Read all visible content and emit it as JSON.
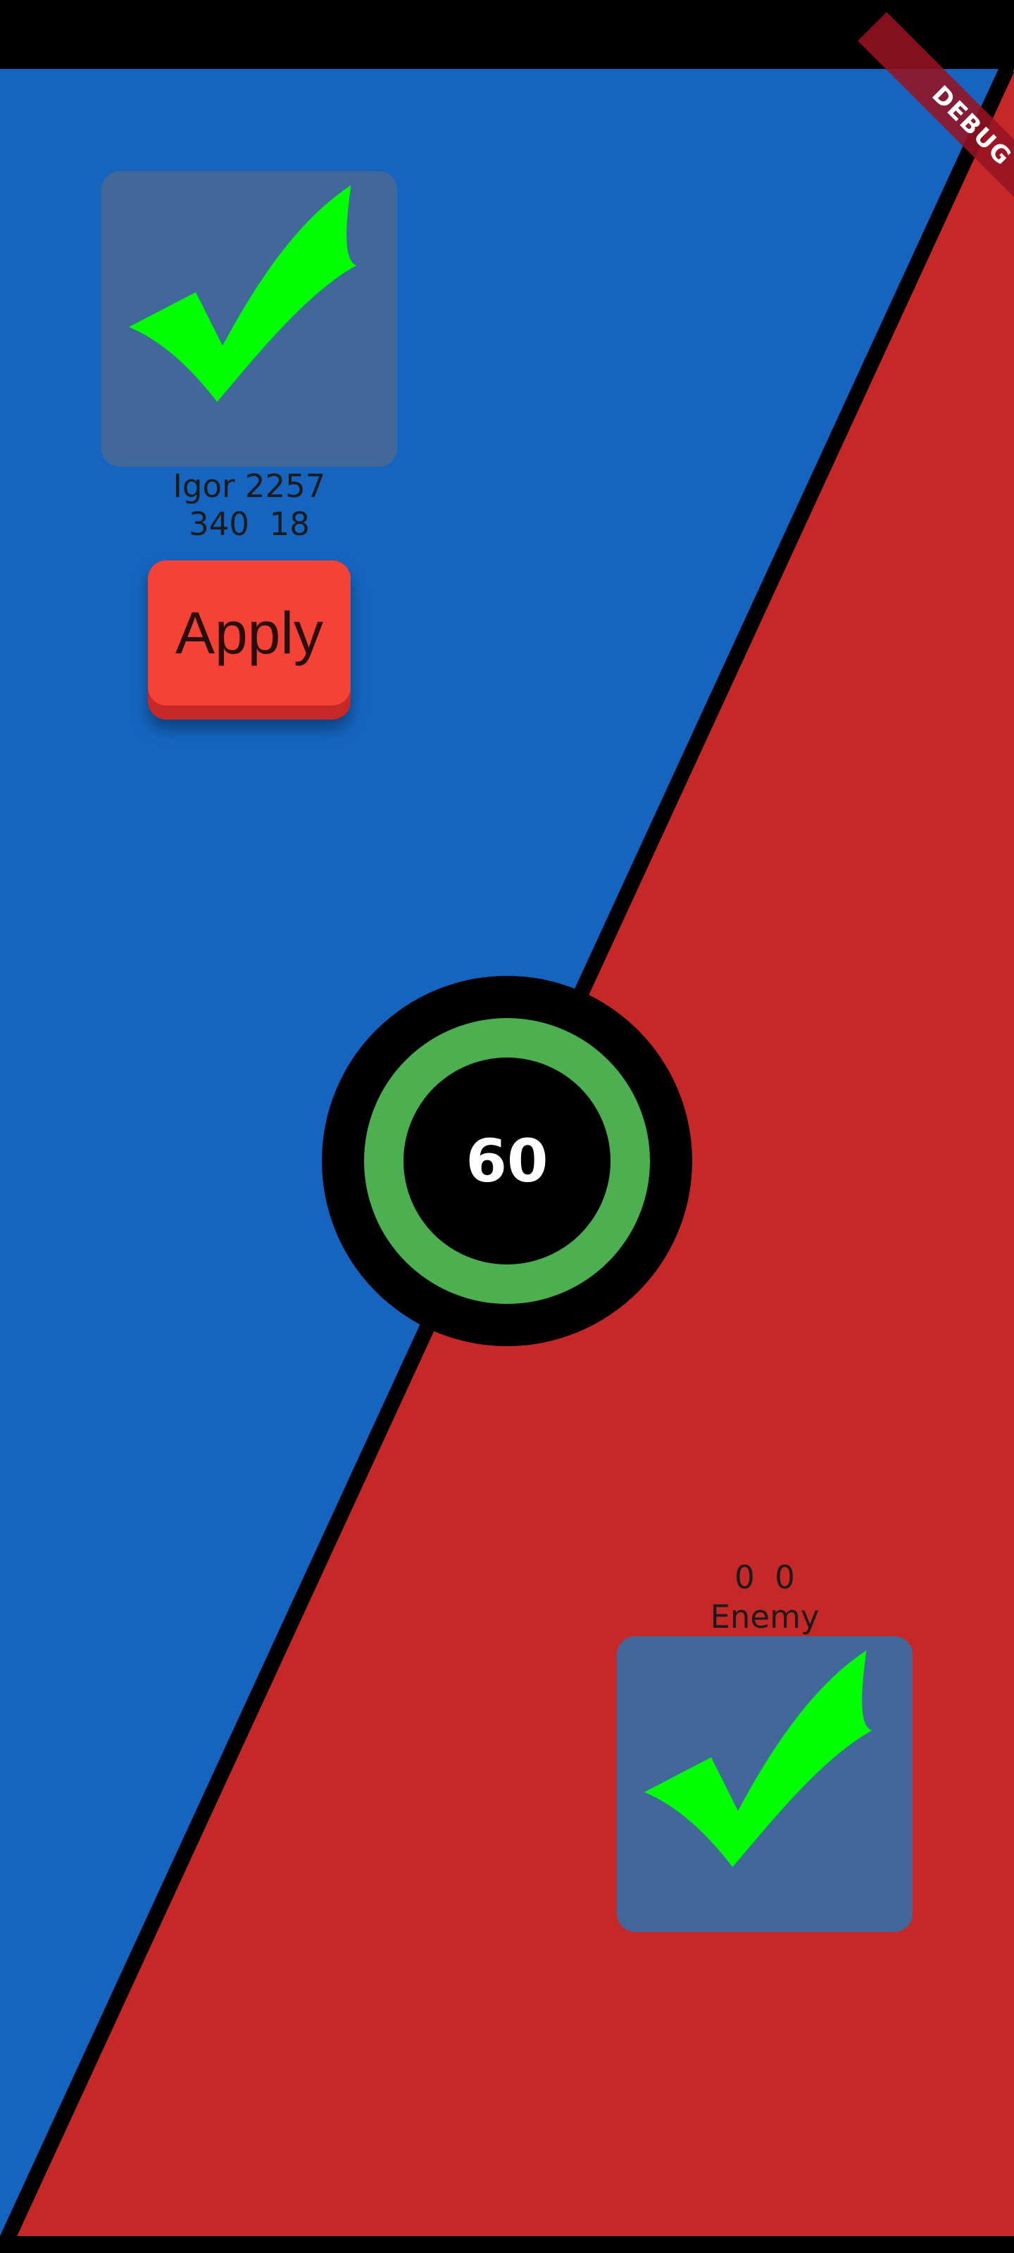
{
  "player": {
    "name_line": "Igor 2257",
    "stats_line": "340  18",
    "card_icon": "checkmark-icon"
  },
  "enemy": {
    "stats_line": "0  0",
    "name_line": "Enemy",
    "card_icon": "checkmark-icon"
  },
  "apply_button": {
    "label": "Apply"
  },
  "timer": {
    "value": "60"
  },
  "debug_banner": {
    "label": "DEBUG"
  },
  "colors": {
    "player_side": "#1565C0",
    "enemy_side": "#C62828",
    "card_background": "#41679B",
    "checkmark": "#00FF00",
    "timer_ring": "#4CAF50",
    "apply_button": "#F44336"
  }
}
